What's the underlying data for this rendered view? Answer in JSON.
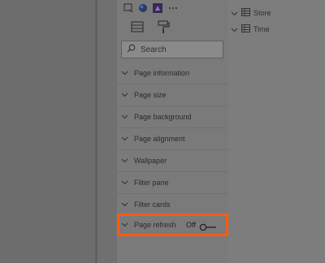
{
  "visualizations": {
    "icons": [
      "filter-card-icon",
      "globe-icon",
      "power-apps-icon",
      "more-icon"
    ]
  },
  "format_tabs": [
    {
      "name": "fields-tab-icon",
      "active": false
    },
    {
      "name": "format-paint-roller-icon",
      "active": true
    }
  ],
  "search": {
    "placeholder": "Search"
  },
  "format_sections": [
    {
      "label": "Page information"
    },
    {
      "label": "Page size"
    },
    {
      "label": "Page background"
    },
    {
      "label": "Page alignment"
    },
    {
      "label": "Wallpaper"
    },
    {
      "label": "Filter pane"
    },
    {
      "label": "Filter cards"
    },
    {
      "label": "Page refresh",
      "toggle_label": "Off",
      "toggle_on": false,
      "highlighted": true
    }
  ],
  "fields": [
    {
      "label": "Store"
    },
    {
      "label": "Time"
    }
  ],
  "colors": {
    "highlight": "#ff5a12",
    "active_tab_underline": "#c8a800"
  }
}
